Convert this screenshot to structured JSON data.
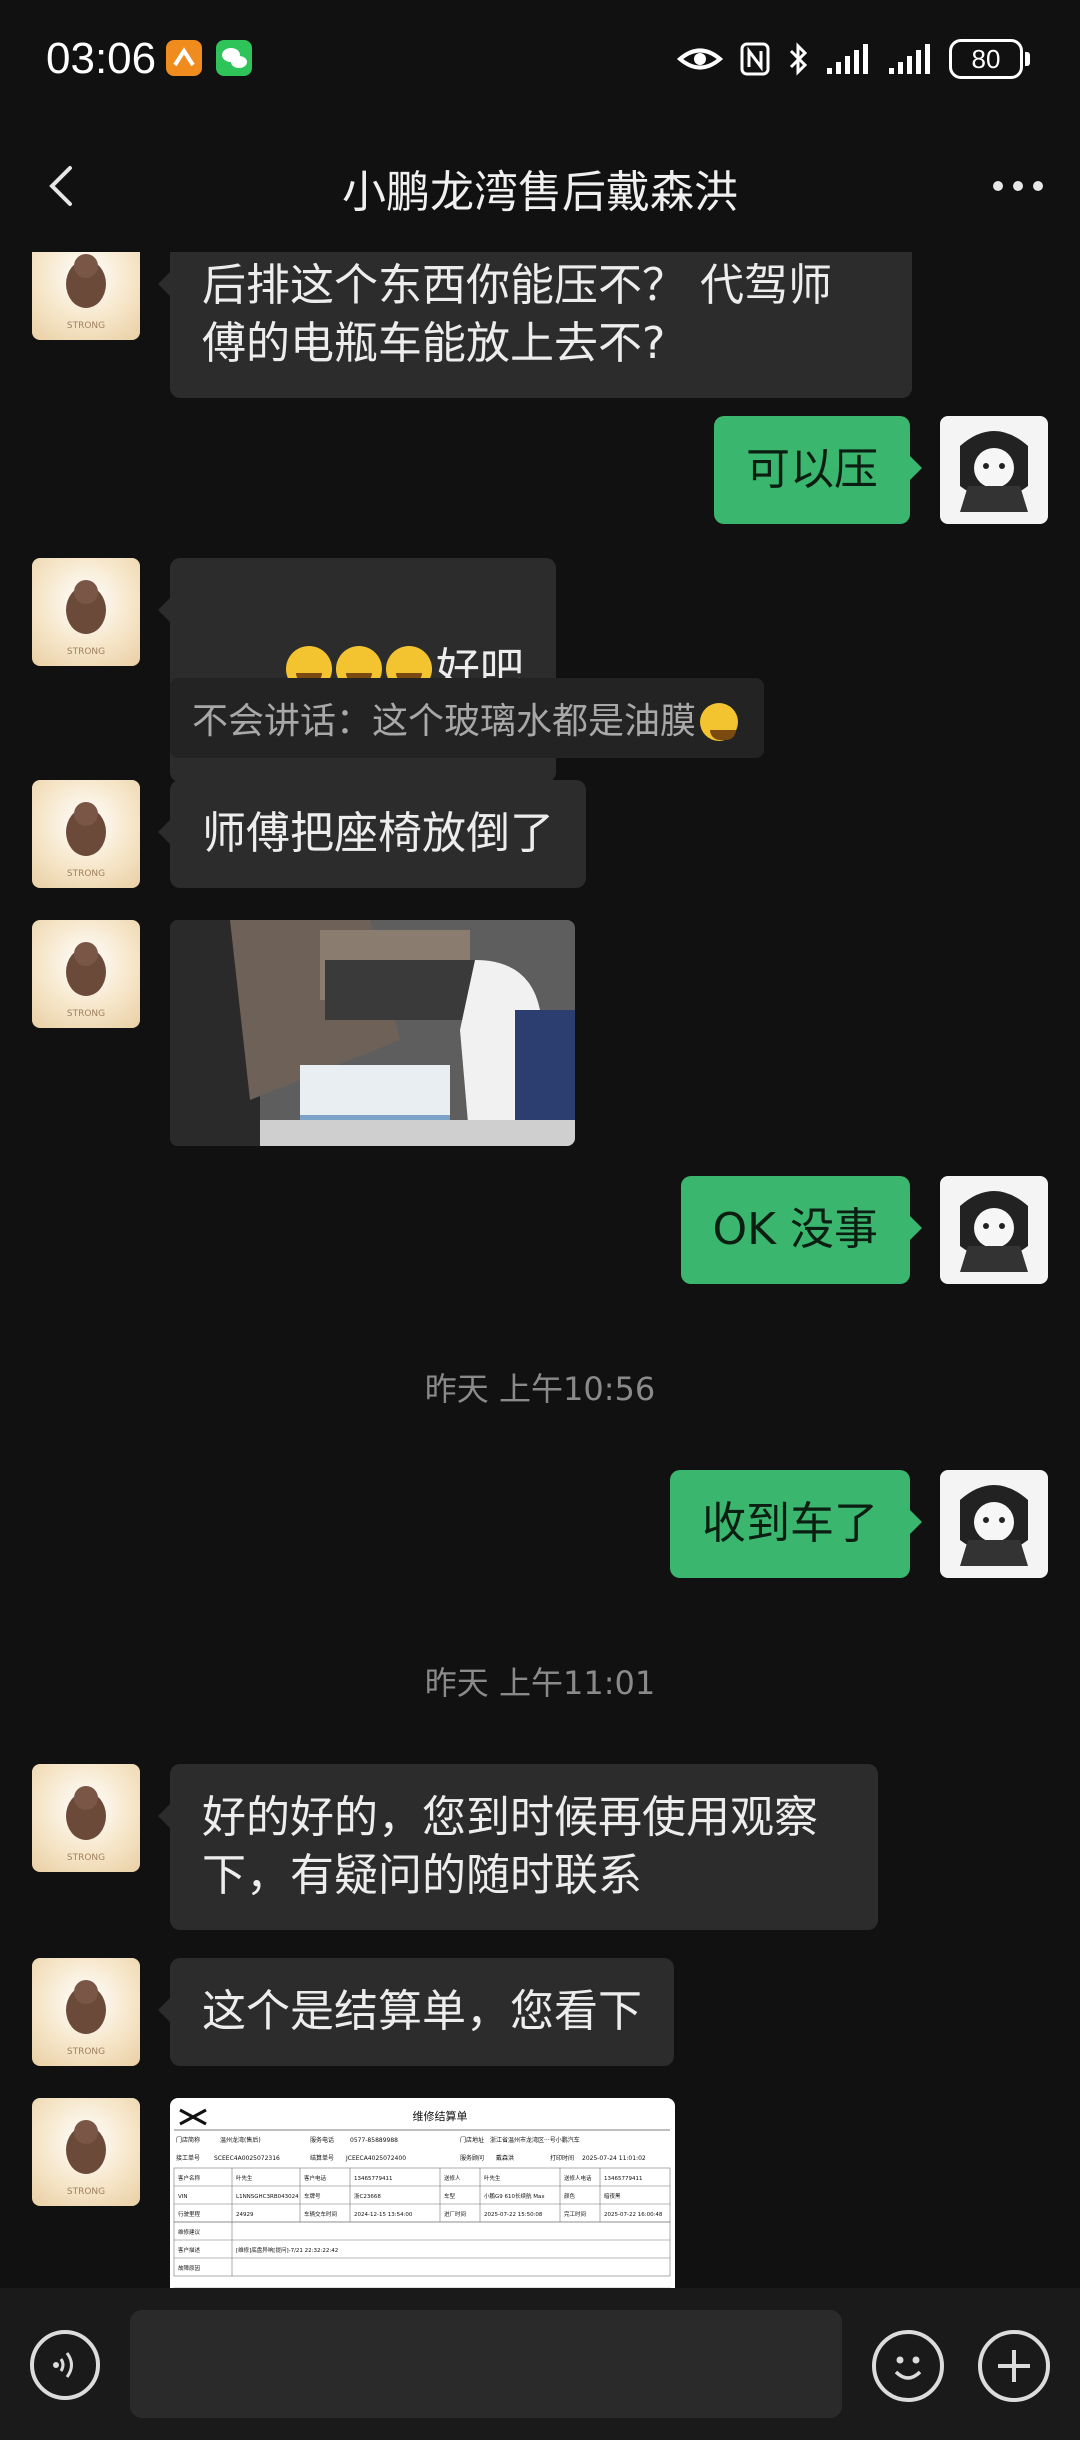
{
  "status_bar": {
    "time": "03:06",
    "battery": "80",
    "icons": [
      "orange-app-icon",
      "wechat-icon",
      "eye-icon",
      "nfc-icon",
      "bluetooth-icon",
      "signal-icon",
      "signal-icon"
    ]
  },
  "header": {
    "title": "小鹏龙湾售后戴森洪",
    "back_icon": "chevron-left-icon",
    "more_icon": "more-dots-icon"
  },
  "messages": {
    "m1": "后排这个东西你能压不？ 代驾师\n傅的电瓶车能放上去不?",
    "m2": "可以压",
    "m3": "好吧",
    "m3_quote": "不会讲话：这个玻璃水都是油膜",
    "m4": "师傅把座椅放倒了",
    "m6": "OK 没事",
    "ts1": "昨天 上午10:56",
    "m7": "收到车了",
    "ts2": "昨天 上午11:01",
    "m8": "好的好的，您到时候再使用观察\n下，有疑问的随时联系",
    "m9": "这个是结算单，您看下"
  },
  "receipt": {
    "title": "维修结算单",
    "row1": [
      "门店简称",
      "温州龙湾(售后)",
      "服务电话",
      "0577-85889988",
      "门店地址",
      "浙江省温州市龙湾区···号小鹏汽车"
    ],
    "row2": [
      "接工单号",
      "SCEEC4A0025072316",
      "结算单号",
      "JCEECA4025072400",
      "服务顾问",
      "戴森洪",
      "打印时间",
      "2025-07-24 11:01:02"
    ],
    "rows": [
      [
        "客户名称",
        "叶先生",
        "客户电话",
        "13465779411",
        "送修人",
        "叶先生",
        "送修人电话",
        "13465779411"
      ],
      [
        "VIN",
        "L1NNSGHC3RB043024",
        "车牌号",
        "浙C23668",
        "车型",
        "小鹏G9 610长续航 Max",
        "颜色",
        "暗夜黑"
      ],
      [
        "行驶里程",
        "24929",
        "车辆交车时间",
        "2024-12-15 13:54:00",
        "进厂时间",
        "2025-07-22 15:50:08",
        "完工时间",
        "2025-07-22 16:00:48"
      ]
    ],
    "repair_label": "维修建议",
    "customer_label": "客户描述",
    "customer_text": "[维修]底盘异响[提问]-7/21 22:32:22:42",
    "fault_label": "故障原因"
  },
  "input_bar": {
    "voice_icon": "voice-icon",
    "emoji_icon": "emoji-icon",
    "plus_icon": "plus-icon"
  }
}
